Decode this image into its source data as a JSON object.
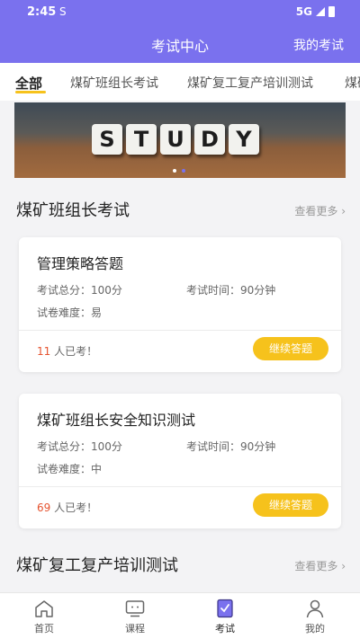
{
  "status_bar": {
    "time": "2:45",
    "app_glyph": "S",
    "network": "5G"
  },
  "header": {
    "title": "考试中心",
    "my_exams": "我的考试"
  },
  "tabs": [
    {
      "label": "全部",
      "active": true
    },
    {
      "label": "煤矿班组长考试",
      "active": false
    },
    {
      "label": "煤矿复工复产培训测试",
      "active": false
    },
    {
      "label": "煤矿",
      "active": false
    }
  ],
  "banner": {
    "letters": [
      "S",
      "T",
      "U",
      "D",
      "Y"
    ]
  },
  "sections": [
    {
      "title": "煤矿班组长考试",
      "more": "查看更多 ›",
      "cards": [
        {
          "name": "管理策略答题",
          "total_score": "考试总分：100分",
          "duration": "考试时间：90分钟",
          "difficulty": "试卷难度：易",
          "taken_count": "11",
          "taken_suffix": " 人已考！",
          "button": "继续答题"
        },
        {
          "name": "煤矿班组长安全知识测试",
          "total_score": "考试总分：100分",
          "duration": "考试时间：90分钟",
          "difficulty": "试卷难度：中",
          "taken_count": "69",
          "taken_suffix": " 人已考！",
          "button": "继续答题"
        }
      ]
    },
    {
      "title": "煤矿复工复产培训测试",
      "more": "查看更多 ›"
    }
  ],
  "tabbar": [
    {
      "label": "首页",
      "icon": "home-icon",
      "active": false
    },
    {
      "label": "课程",
      "icon": "course-icon",
      "active": false
    },
    {
      "label": "考试",
      "icon": "exam-icon",
      "active": true
    },
    {
      "label": "我的",
      "icon": "profile-icon",
      "active": false
    }
  ],
  "colors": {
    "primary": "#7a71ee",
    "accent": "#f6c21c",
    "count": "#e5532f"
  }
}
